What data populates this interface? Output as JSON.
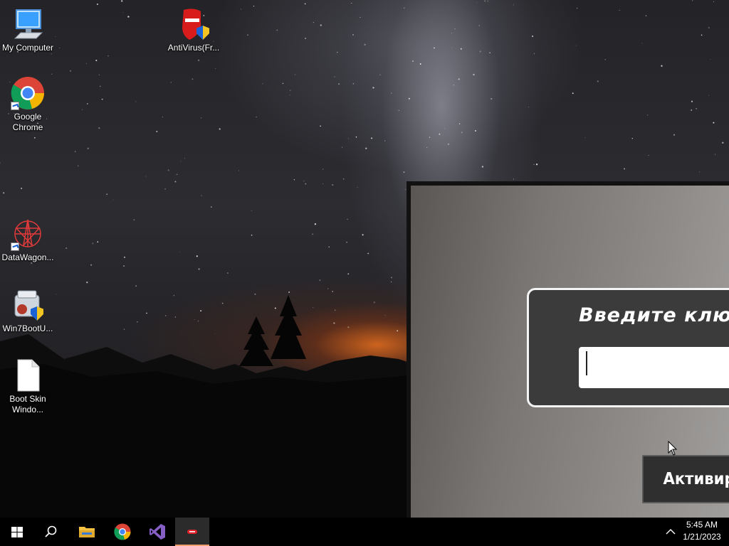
{
  "desktop": {
    "icons": [
      {
        "label": "My Computer",
        "icon": "computer-icon"
      },
      {
        "label": "AntiVirus(Fr...",
        "icon": "antivirus-icon"
      },
      {
        "label": "Google Chrome",
        "icon": "chrome-icon"
      },
      {
        "label": "DataWagon...",
        "icon": "datawagon-icon"
      },
      {
        "label": "Win7BootU...",
        "icon": "installer-icon"
      },
      {
        "label": "Boot Skin Windo...",
        "icon": "file-icon"
      }
    ]
  },
  "app": {
    "prompt": "Введите ключ",
    "key_value": "",
    "activate_label": "Активир"
  },
  "taskbar": {
    "items": [
      "start-icon",
      "search-icon",
      "file-explorer-icon",
      "chrome-icon",
      "visual-studio-icon",
      "app-icon"
    ],
    "time": "5:45 AM",
    "date": "1/21/2023"
  },
  "colors": {
    "taskbar": "#000000",
    "panel": "#3b3b3c",
    "active_indicator": "#f0a070"
  }
}
